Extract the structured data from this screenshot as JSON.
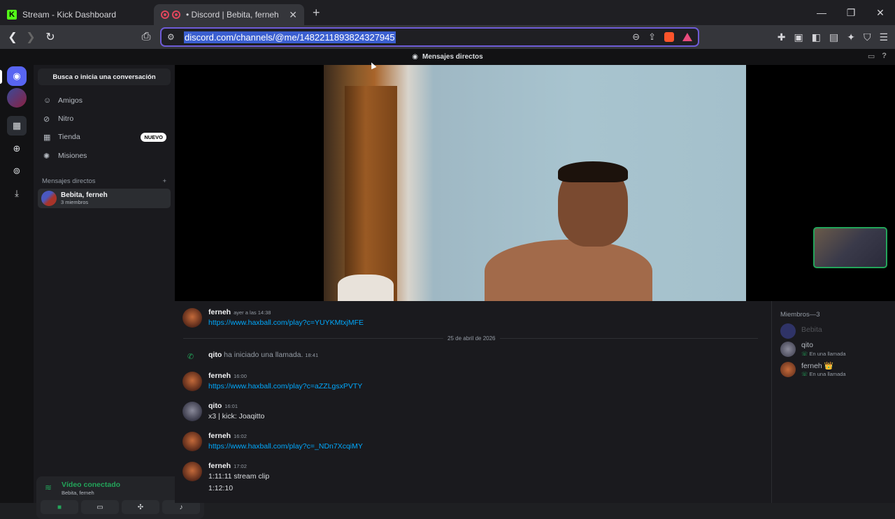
{
  "browser": {
    "tabs": [
      {
        "title": "Stream - Kick Dashboard"
      },
      {
        "title": "• Discord | Bebita, ferneh"
      }
    ],
    "new_tab": "+",
    "url": "discord.com/channels/@me/1482211893824327945"
  },
  "discord": {
    "top_title": "Mensajes directos",
    "search_placeholder": "Busca o inicia una conversación",
    "nav": [
      {
        "label": "Amigos",
        "icon": "friends-icon"
      },
      {
        "label": "Nitro",
        "icon": "nitro-icon"
      },
      {
        "label": "Tienda",
        "icon": "shop-icon",
        "badge": "NUEVO"
      },
      {
        "label": "Misiones",
        "icon": "quests-icon"
      }
    ],
    "dm_header": "Mensajes directos",
    "dm_add": "+",
    "dm_item": {
      "name": "Bebita, ferneh",
      "sub": "3 miembros"
    },
    "voice": {
      "status": "Vídeo conectado",
      "channel": "Bebita, ferneh"
    },
    "messages": [
      {
        "author": "ferneh",
        "time": "ayer a las 14:38",
        "link": "https://www.haxball.com/play?c=YUYKMtxjMFE"
      },
      {
        "author": "ferneh",
        "time": "16:00",
        "link": "https://www.haxball.com/play?c=aZZLgsxPVTY"
      },
      {
        "author": "qito",
        "time": "16:01",
        "text": "x3 | kick: Joaqitto"
      },
      {
        "author": "ferneh",
        "time": "16:02",
        "link": "https://www.haxball.com/play?c=_NDn7XcqiMY"
      },
      {
        "author": "ferneh",
        "time": "17:02",
        "text": "1:11:11 stream clip",
        "text2": "1:12:10"
      }
    ],
    "date_divider": "25 de abril de 2026",
    "call": {
      "author": "qito",
      "text": " ha iniciado una llamada.",
      "time": "18:41"
    },
    "members": {
      "header": "Miembros—3",
      "list": [
        {
          "name": "Bebita",
          "sub": ""
        },
        {
          "name": "qito",
          "sub": "En una llamada"
        },
        {
          "name": "ferneh",
          "crown": "👑",
          "sub": "En una llamada"
        }
      ]
    }
  }
}
